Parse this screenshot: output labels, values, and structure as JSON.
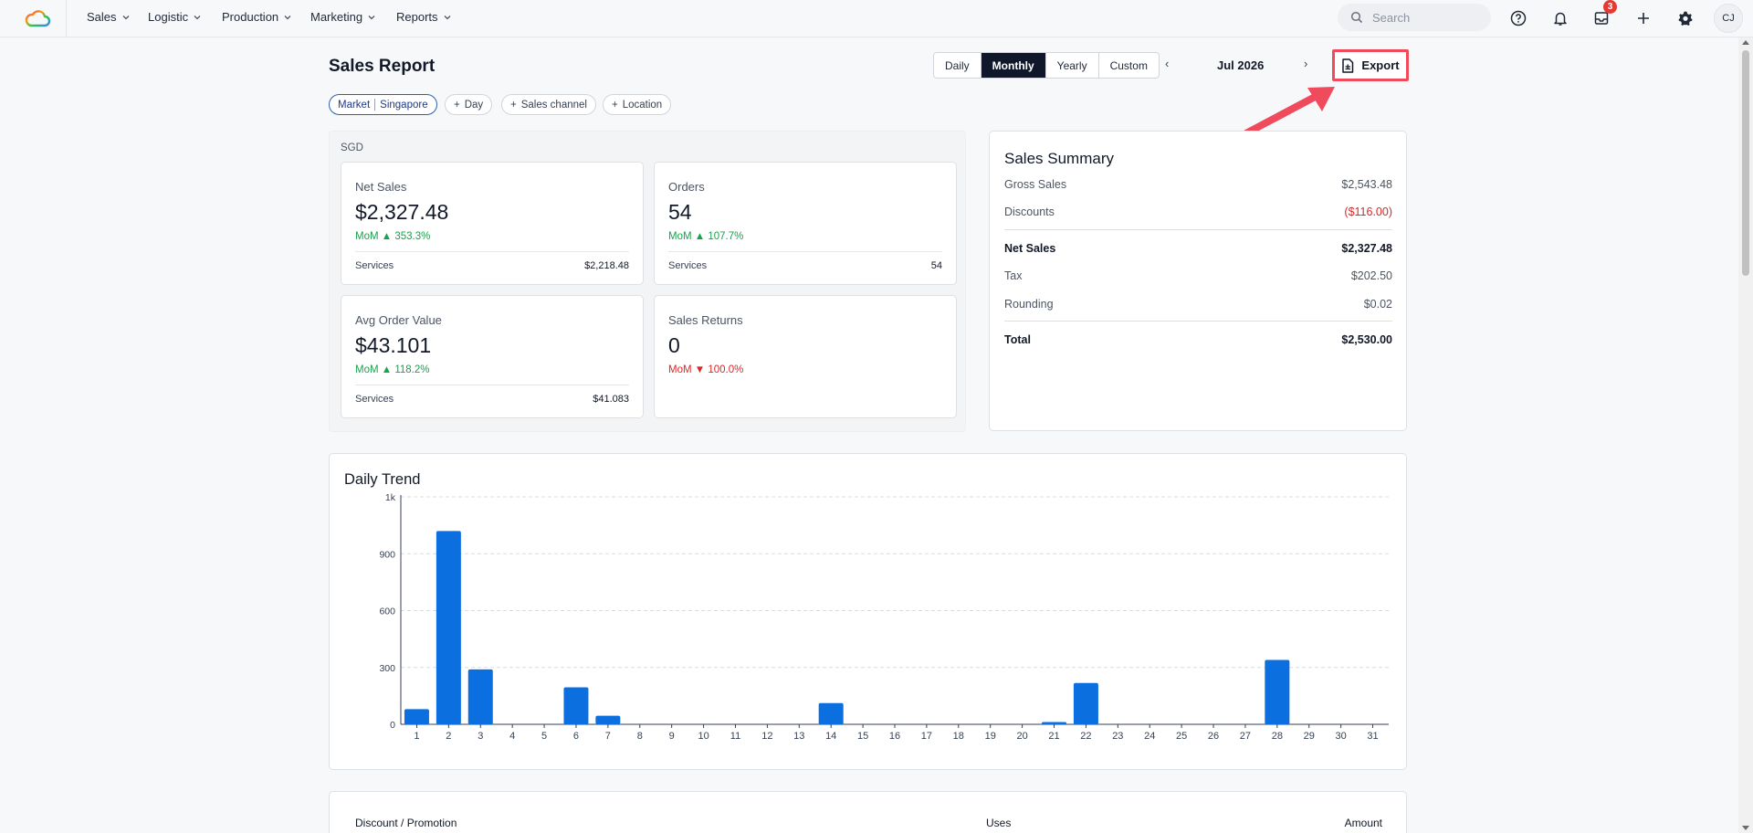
{
  "nav": {
    "items": [
      {
        "label": "Sales"
      },
      {
        "label": "Logistic"
      },
      {
        "label": "Production"
      },
      {
        "label": "Marketing"
      },
      {
        "label": "Reports"
      }
    ],
    "search_placeholder": "Search",
    "inbox_badge": "3",
    "avatar_initials": "CJ"
  },
  "header": {
    "title": "Sales Report",
    "periods": [
      "Daily",
      "Monthly",
      "Yearly",
      "Custom"
    ],
    "active_period": "Monthly",
    "month": "Jul 2026",
    "prev": "‹",
    "next": "›",
    "export_label": "Export"
  },
  "filters": {
    "market_key": "Market",
    "market_value": "Singapore",
    "add_day": "Day",
    "add_channel": "Sales channel",
    "add_location": "Location"
  },
  "metrics": {
    "currency": "SGD",
    "net_sales": {
      "label": "Net Sales",
      "value": "$2,327.48",
      "mom": "MoM ▲ 353.3%",
      "foot_label": "Services",
      "foot_value": "$2,218.48"
    },
    "orders": {
      "label": "Orders",
      "value": "54",
      "mom": "MoM ▲ 107.7%",
      "foot_label": "Services",
      "foot_value": "54"
    },
    "avg_order": {
      "label": "Avg Order Value",
      "value": "$43.101",
      "mom": "MoM ▲ 118.2%",
      "foot_label": "Services",
      "foot_value": "$41.083"
    },
    "returns": {
      "label": "Sales Returns",
      "value": "0",
      "mom": "MoM ▼ 100.0%"
    }
  },
  "summary": {
    "title": "Sales Summary",
    "gross_label": "Gross Sales",
    "gross_value": "$2,543.48",
    "discounts_label": "Discounts",
    "discounts_value": "($116.00)",
    "net_label": "Net Sales",
    "net_value": "$2,327.48",
    "tax_label": "Tax",
    "tax_value": "$202.50",
    "rounding_label": "Rounding",
    "rounding_value": "$0.02",
    "total_label": "Total",
    "total_value": "$2,530.00"
  },
  "trend": {
    "title": "Daily Trend"
  },
  "chart_data": {
    "type": "bar",
    "title": "Daily Trend",
    "xlabel": "",
    "ylabel": "",
    "ylim": [
      0,
      1200
    ],
    "yticks": [
      0,
      300,
      600,
      900,
      1200
    ],
    "ytick_labels": [
      "0",
      "300",
      "600",
      "900",
      "1k"
    ],
    "grid": true,
    "color": "#0b6fe0",
    "categories": [
      "1",
      "2",
      "3",
      "4",
      "5",
      "6",
      "7",
      "8",
      "9",
      "10",
      "11",
      "12",
      "13",
      "14",
      "15",
      "16",
      "17",
      "18",
      "19",
      "20",
      "21",
      "22",
      "23",
      "24",
      "25",
      "26",
      "27",
      "28",
      "29",
      "30",
      "31"
    ],
    "values": [
      80,
      1020,
      290,
      0,
      0,
      195,
      45,
      0,
      0,
      0,
      0,
      0,
      0,
      112,
      0,
      0,
      0,
      0,
      0,
      0,
      12,
      218,
      0,
      0,
      0,
      0,
      0,
      340,
      0,
      0,
      0
    ]
  },
  "discount_table": {
    "col_name": "Discount / Promotion",
    "col_uses": "Uses",
    "col_amount": "Amount"
  }
}
